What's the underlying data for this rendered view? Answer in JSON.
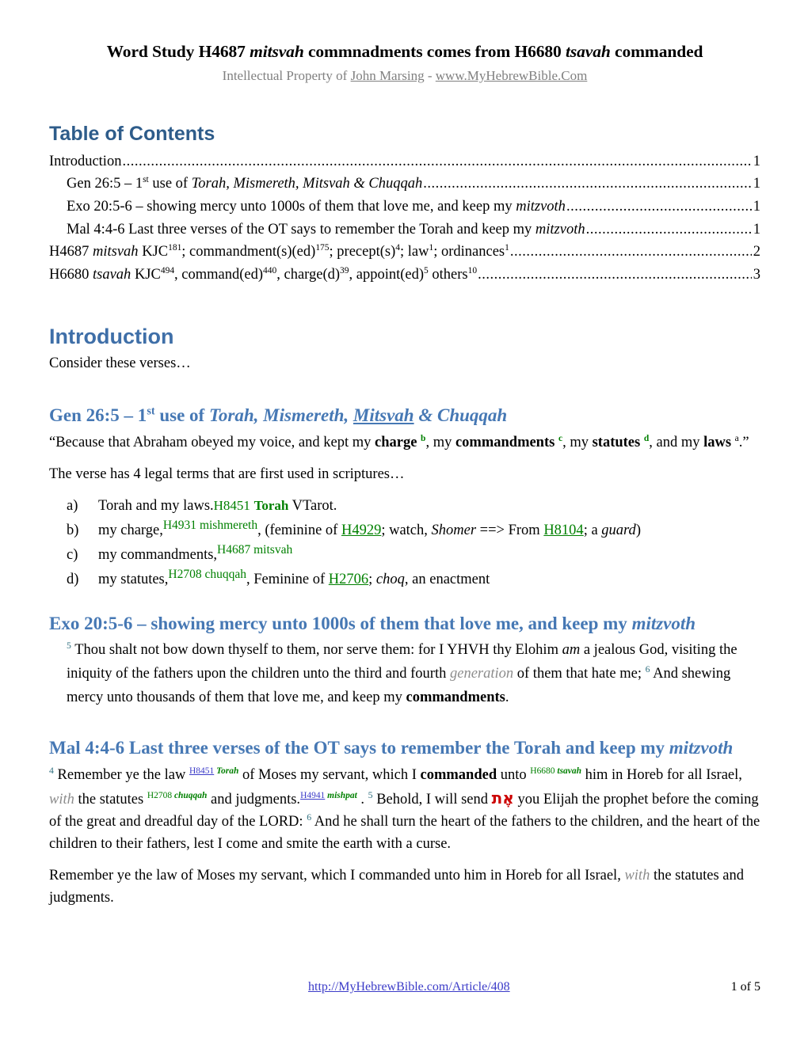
{
  "document": {
    "title_parts": [
      {
        "text": "Word Study H4687 ",
        "style": "bold"
      },
      {
        "text": "mitsvah",
        "style": "bold-italic"
      },
      {
        "text": " commnadments comes from H6680 ",
        "style": "bold"
      },
      {
        "text": "tsavah",
        "style": "bold-italic"
      },
      {
        "text": " commanded",
        "style": "bold"
      }
    ],
    "title_plain": "Word Study H4687 mitsvah commnadments comes from H6680 tsavah commanded",
    "subtitle_prefix": "Intellectual Property of ",
    "subtitle_author": "John Marsing",
    "subtitle_sep": " - ",
    "subtitle_site": "www.MyHebrewBible.Com"
  },
  "toc": {
    "heading": "Table of Contents",
    "entries": [
      {
        "level": 1,
        "text": "Introduction",
        "page": "1"
      },
      {
        "level": 2,
        "text": "Gen 26:5 – 1st use of Torah, Mismereth, Mitsvah & Chuqqah",
        "page": "1"
      },
      {
        "level": 2,
        "text": "Exo 20:5-6 – showing mercy unto 1000s of them that love me, and keep my mitzvoth",
        "page": "1"
      },
      {
        "level": 2,
        "text": "Mal 4:4-6 Last three verses of the OT says to remember the Torah and keep my mitzvoth",
        "page": "1"
      },
      {
        "level": 1,
        "text": "H4687 mitsvah KJC181; commandment(s)(ed)175; precept(s)4; law1; ordinances1",
        "page": "2"
      },
      {
        "level": 1,
        "text": "H6680 tsavah KJC494, command(ed)440, charge(d)39, appoint(ed)5 others10",
        "page": "3"
      }
    ],
    "dot_leader": "................................................................................................................................................................................................................................."
  },
  "introduction": {
    "heading": "Introduction",
    "lead": "Consider these verses…"
  },
  "gen_section": {
    "heading_parts": {
      "prefix": "Gen 26:5 – 1",
      "sup": "st",
      "mid": " use of ",
      "italic1": "Torah, Mismereth, ",
      "italic_underlined": "Mitsvah",
      "italic2": " & Chuqqah"
    },
    "heading_plain": "Gen 26:5 – 1st use of Torah, Mismereth, Mitsvah & Chuqqah",
    "quote": {
      "open": "“Because that Abraham obeyed my voice, and kept my ",
      "w1": "charge",
      "s1": "b",
      "t1": ", my ",
      "w2": "commandments",
      "s2": "c",
      "t2": ", my ",
      "w3": "statutes",
      "s3": "d",
      "t3": ", and my ",
      "w4": "laws",
      "s4": "a",
      "close": ".”"
    },
    "intro_line": "The verse has 4 legal terms that are first used in scriptures…",
    "items": [
      {
        "marker": "a)",
        "text": "Torah and my laws.",
        "strongs_num": "H8451",
        "strongs_word": "Torah",
        "tail": "VTarot.",
        "style": "large"
      },
      {
        "marker": "b)",
        "text": "my charge,",
        "strongs_num": "H4931",
        "strongs_word": "mishmereth",
        "tail_1": ", (feminine of ",
        "link_1": "H4929",
        "tail_2": "; watch,  ",
        "italic_1": "Shomer",
        "tail_3": " ==> From ",
        "link_2": "H8104",
        "tail_4": "; a ",
        "italic_2": "guard",
        "tail_5": ")",
        "style": "sup"
      },
      {
        "marker": "c)",
        "text": "my commandments,",
        "strongs_num": "H4687",
        "strongs_word": "mitsvah",
        "tail": "",
        "style": "sup"
      },
      {
        "marker": "d)",
        "text": "my statutes,",
        "strongs_num": "H2708",
        "strongs_word": "chuqqah",
        "tail_1": ", Feminine of ",
        "link_1": "H2706",
        "tail_2": "; ",
        "italic_1": "choq",
        "tail_3": ", an enactment",
        "style": "sup"
      }
    ]
  },
  "exo_section": {
    "heading_plain": "Exo 20:5-6 – showing mercy unto 1000s of them that love me, and keep my mitzvoth",
    "heading_main": "Exo 20:5-6 – showing mercy unto 1000s of them that love me, and keep my ",
    "heading_italic": "mitzvoth",
    "verse": {
      "n5": "5",
      "p1": " Thou shalt not bow down thyself to them, nor serve them: for I YHVH thy Elohim ",
      "i1": "am",
      "p2": " a jealous God, visiting  the iniquity of the fathers upon the children unto the third and fourth ",
      "i2": "generation",
      "p3": " of them that hate me; ",
      "n6": "6",
      "p4": " And shewing mercy unto thousands of them that love me, and keep my ",
      "b1": "commandments",
      "p5": "."
    }
  },
  "mal_section": {
    "heading_plain": "Mal 4:4-6 Last three verses of the OT says to remember the Torah and keep my mitzvoth",
    "heading_main": "Mal 4:4-6 Last three verses of the OT says to remember the Torah and keep my ",
    "heading_italic": "mitzvoth",
    "verse": {
      "n4": "4",
      "p1": " Remember ye the law ",
      "ref1_link": "H8451",
      "ref1_word": "Torah",
      "p2": " of Moses my servant, which I ",
      "b1": "commanded",
      "p3": " unto ",
      "ref2_num": "H6680",
      "ref2_word": "tsavah",
      "p4": " him in Horeb for all Israel, ",
      "i1": "with",
      "p5": " the statutes ",
      "ref3_num": "H2708",
      "ref3_word": "chuqqah",
      "p6": " and judgments.",
      "ref4_link": "H4941",
      "ref4_word": "mishpat",
      "p7": " .  ",
      "n5": "5",
      "p8": " Behold, I will send ",
      "hebrew": "אֶת",
      "p9": " you Elijah the prophet before the coming of the great and dreadful day of the LORD:  ",
      "n6": "6",
      "p10": " And he shall turn the heart of the fathers to the children, and the heart of the children to their fathers, lest I come and smite the earth with a curse."
    },
    "restatement": {
      "p1": "Remember ye the law of Moses my servant, which I commanded unto him in Horeb for all Israel, ",
      "i1": "with",
      "p2": " the statutes and judgments."
    }
  },
  "footer": {
    "url": "http://MyHebrewBible.com/Article/408",
    "page": "1 of 5"
  },
  "colors": {
    "heading_toc": "#2E5C8A",
    "heading_main": "#3F6FA8",
    "heading_section": "#4678B4",
    "strongs_green": "#008000",
    "link_blue": "#3B3BC8",
    "hebrew_red": "#CC0000",
    "subtitle_gray": "#808080",
    "verse_num_teal": "#2F6F7F"
  }
}
